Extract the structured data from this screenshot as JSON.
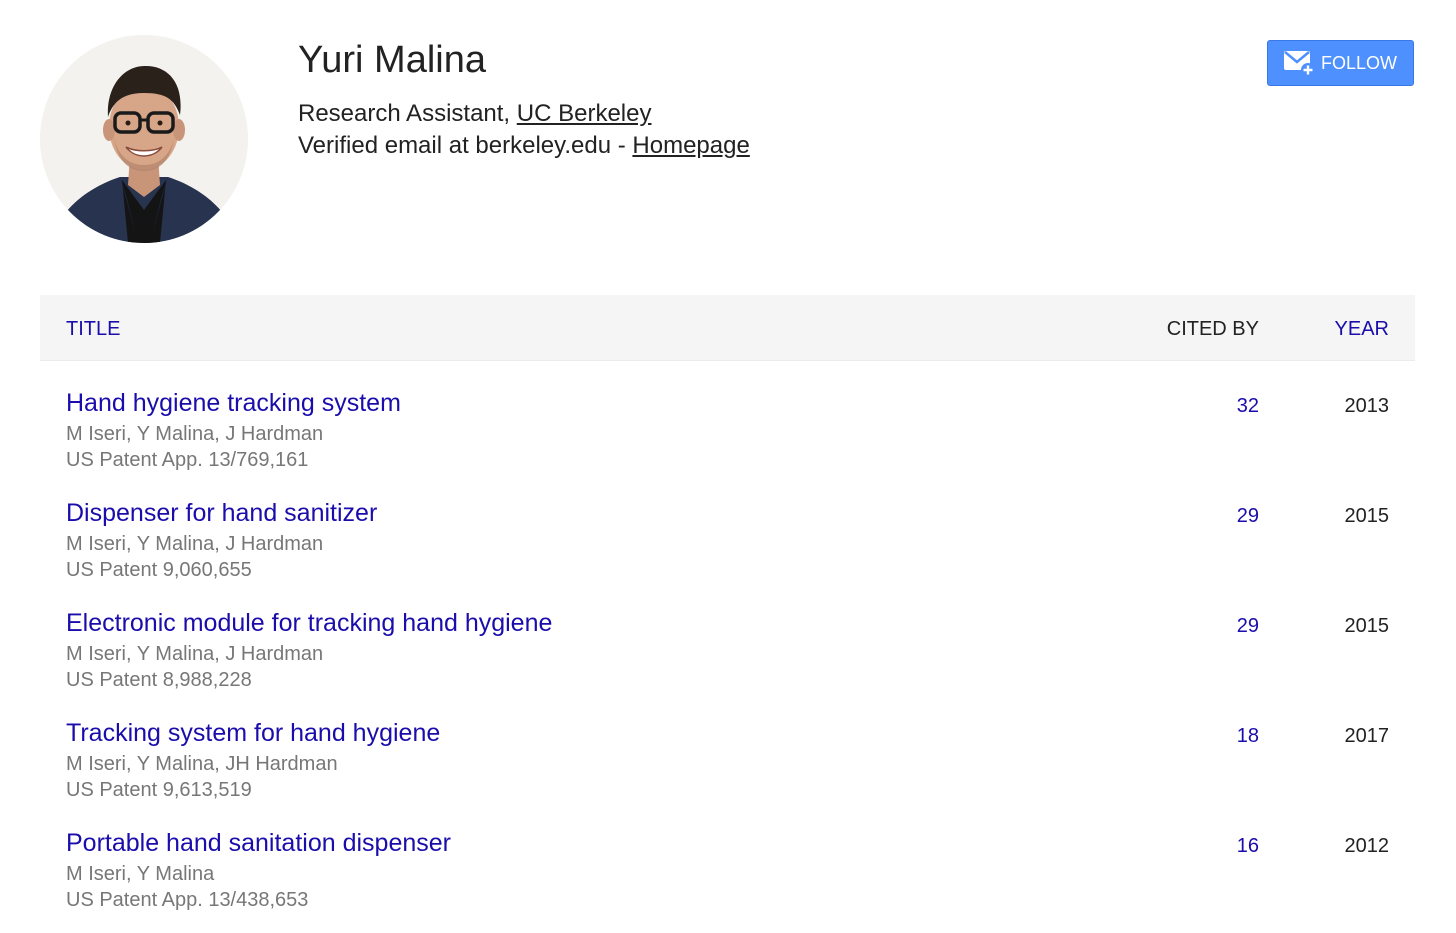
{
  "profile": {
    "name": "Yuri Malina",
    "role": "Research Assistant, ",
    "affiliation": "UC Berkeley",
    "email_text": "Verified email at berkeley.edu - ",
    "homepage_label": "Homepage",
    "avatar_icon": "profile-photo"
  },
  "follow": {
    "label": "FOLLOW",
    "icon": "email-plus-icon",
    "color": "#4d90fe"
  },
  "table": {
    "headers": {
      "title": "TITLE",
      "cited_by": "CITED BY",
      "year": "YEAR"
    },
    "rows": [
      {
        "title": "Hand hygiene tracking system",
        "authors": "M Iseri, Y Malina, J Hardman",
        "publication": "US Patent App. 13/769,161",
        "cited_by": "32",
        "year": "2013"
      },
      {
        "title": "Dispenser for hand sanitizer",
        "authors": "M Iseri, Y Malina, J Hardman",
        "publication": "US Patent 9,060,655",
        "cited_by": "29",
        "year": "2015"
      },
      {
        "title": "Electronic module for tracking hand hygiene",
        "authors": "M Iseri, Y Malina, J Hardman",
        "publication": "US Patent 8,988,228",
        "cited_by": "29",
        "year": "2015"
      },
      {
        "title": "Tracking system for hand hygiene",
        "authors": "M Iseri, Y Malina, JH Hardman",
        "publication": "US Patent 9,613,519",
        "cited_by": "18",
        "year": "2017"
      },
      {
        "title": "Portable hand sanitation dispenser",
        "authors": "M Iseri, Y Malina",
        "publication": "US Patent App. 13/438,653",
        "cited_by": "16",
        "year": "2012"
      }
    ]
  },
  "colors": {
    "link": "#1a0dab",
    "muted": "#777777",
    "header_bg": "#f5f5f5"
  }
}
